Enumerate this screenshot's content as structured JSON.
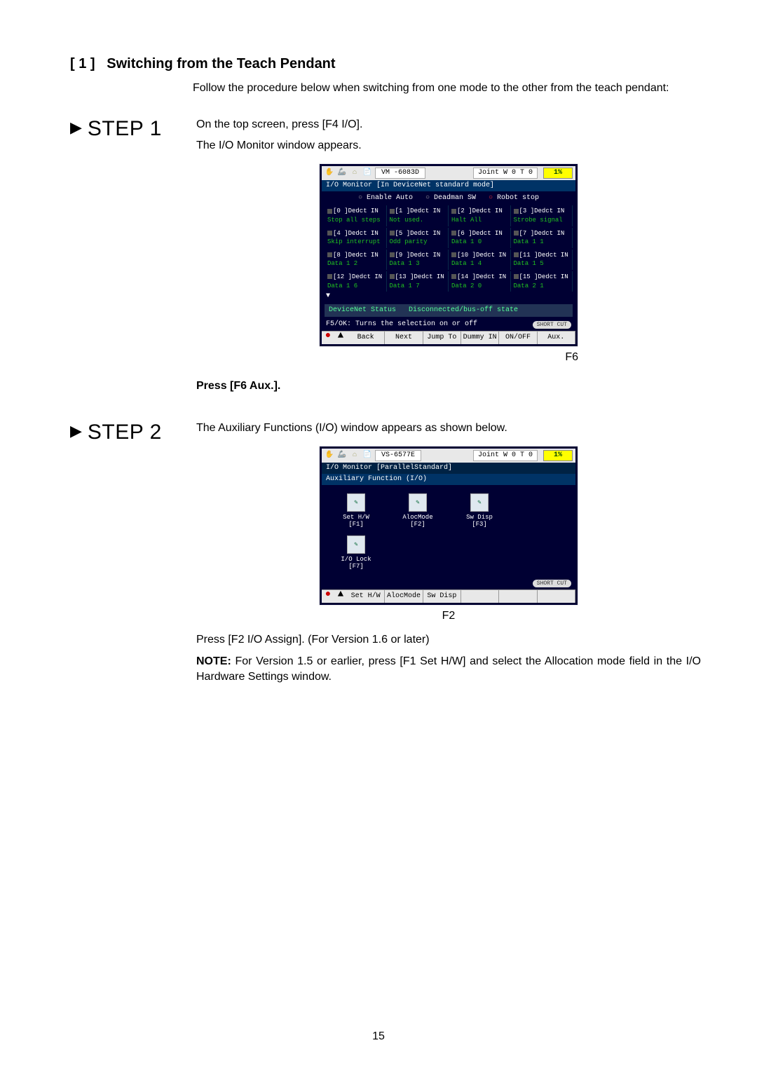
{
  "section": {
    "num": "[ 1 ]",
    "title": "Switching from the Teach Pendant"
  },
  "intro": "Follow the procedure below when switching from one mode to the other from the teach pendant:",
  "steps": {
    "s1": {
      "label": "STEP 1",
      "l1": "On the top screen, press [F4 I/O].",
      "l2": "The I/O Monitor window appears."
    },
    "s2": {
      "label": "STEP 2",
      "l1": "The Auxiliary Functions (I/O) window appears as shown below."
    }
  },
  "screen1": {
    "machine": "VM  -6083D",
    "joint": "Joint  W 0 T 0",
    "speed": "1%",
    "title": "I/O Monitor [In DeviceNet standard mode]",
    "radios": [
      "Enable Auto",
      "Deadman SW",
      "Robot stop"
    ],
    "cells": [
      {
        "t": "[0   ]Dedct IN",
        "b": "Stop all steps"
      },
      {
        "t": "[1   ]Dedct IN",
        "b": "Not used."
      },
      {
        "t": "[2   ]Dedct IN",
        "b": "Halt All"
      },
      {
        "t": "[3   ]Dedct IN",
        "b": "Strobe signal"
      },
      {
        "t": "[4   ]Dedct IN",
        "b": "Skip interrupt"
      },
      {
        "t": "[5   ]Dedct IN",
        "b": "Odd parity"
      },
      {
        "t": "[6   ]Dedct IN",
        "b": "Data 1 0"
      },
      {
        "t": "[7   ]Dedct IN",
        "b": "Data 1 1"
      },
      {
        "t": "[8   ]Dedct IN",
        "b": "Data 1 2"
      },
      {
        "t": "[9   ]Dedct IN",
        "b": "Data 1 3"
      },
      {
        "t": "[10  ]Dedct IN",
        "b": "Data 1 4"
      },
      {
        "t": "[11  ]Dedct IN",
        "b": "Data 1 5"
      },
      {
        "t": "[12  ]Dedct IN",
        "b": "Data 1 6"
      },
      {
        "t": "[13  ]Dedct IN",
        "b": "Data 1 7"
      },
      {
        "t": "[14  ]Dedct IN",
        "b": "Data 2 0"
      },
      {
        "t": "[15  ]Dedct IN",
        "b": "Data 2 1"
      }
    ],
    "devnet_l": "DeviceNet Status",
    "devnet_r": "Disconnected/bus-off state",
    "hint": "F5/OK: Turns the selection on or off",
    "shortcut": "SHORT CUT",
    "softkeys": [
      "Back",
      "Next",
      "Jump To",
      "Dummy IN",
      "ON/OFF",
      "Aux."
    ],
    "caption": "F6"
  },
  "afterS1": "Press [F6 Aux.].",
  "screen2": {
    "machine": "VS-6577E",
    "joint": "Joint  W 0 T 0",
    "speed": "1%",
    "tab": "I/O Monitor [ParallelStandard]",
    "title": "Auxiliary Function (I/O)",
    "apps": [
      {
        "n": "Set H/W",
        "k": "[F1]"
      },
      {
        "n": "AlocMode",
        "k": "[F2]"
      },
      {
        "n": "Sw Disp",
        "k": "[F3]"
      },
      {
        "n": "",
        "k": ""
      },
      {
        "n": "I/O Lock",
        "k": "[F7]"
      },
      {
        "n": "",
        "k": ""
      },
      {
        "n": "",
        "k": ""
      },
      {
        "n": "",
        "k": ""
      }
    ],
    "shortcut": "SHORT CUT",
    "softkeys": [
      "Set H/W",
      "AlocMode",
      "Sw Disp",
      "",
      "",
      ""
    ],
    "caption": "F2"
  },
  "afterS2a": "Press [F2 I/O Assign]. (For Version 1.6 or later)",
  "afterS2b_prefix": "NOTE:",
  "afterS2b": " For Version 1.5 or earlier, press [F1 Set H/W] and select the Allocation mode field in the I/O Hardware Settings window.",
  "pagenum": "15"
}
